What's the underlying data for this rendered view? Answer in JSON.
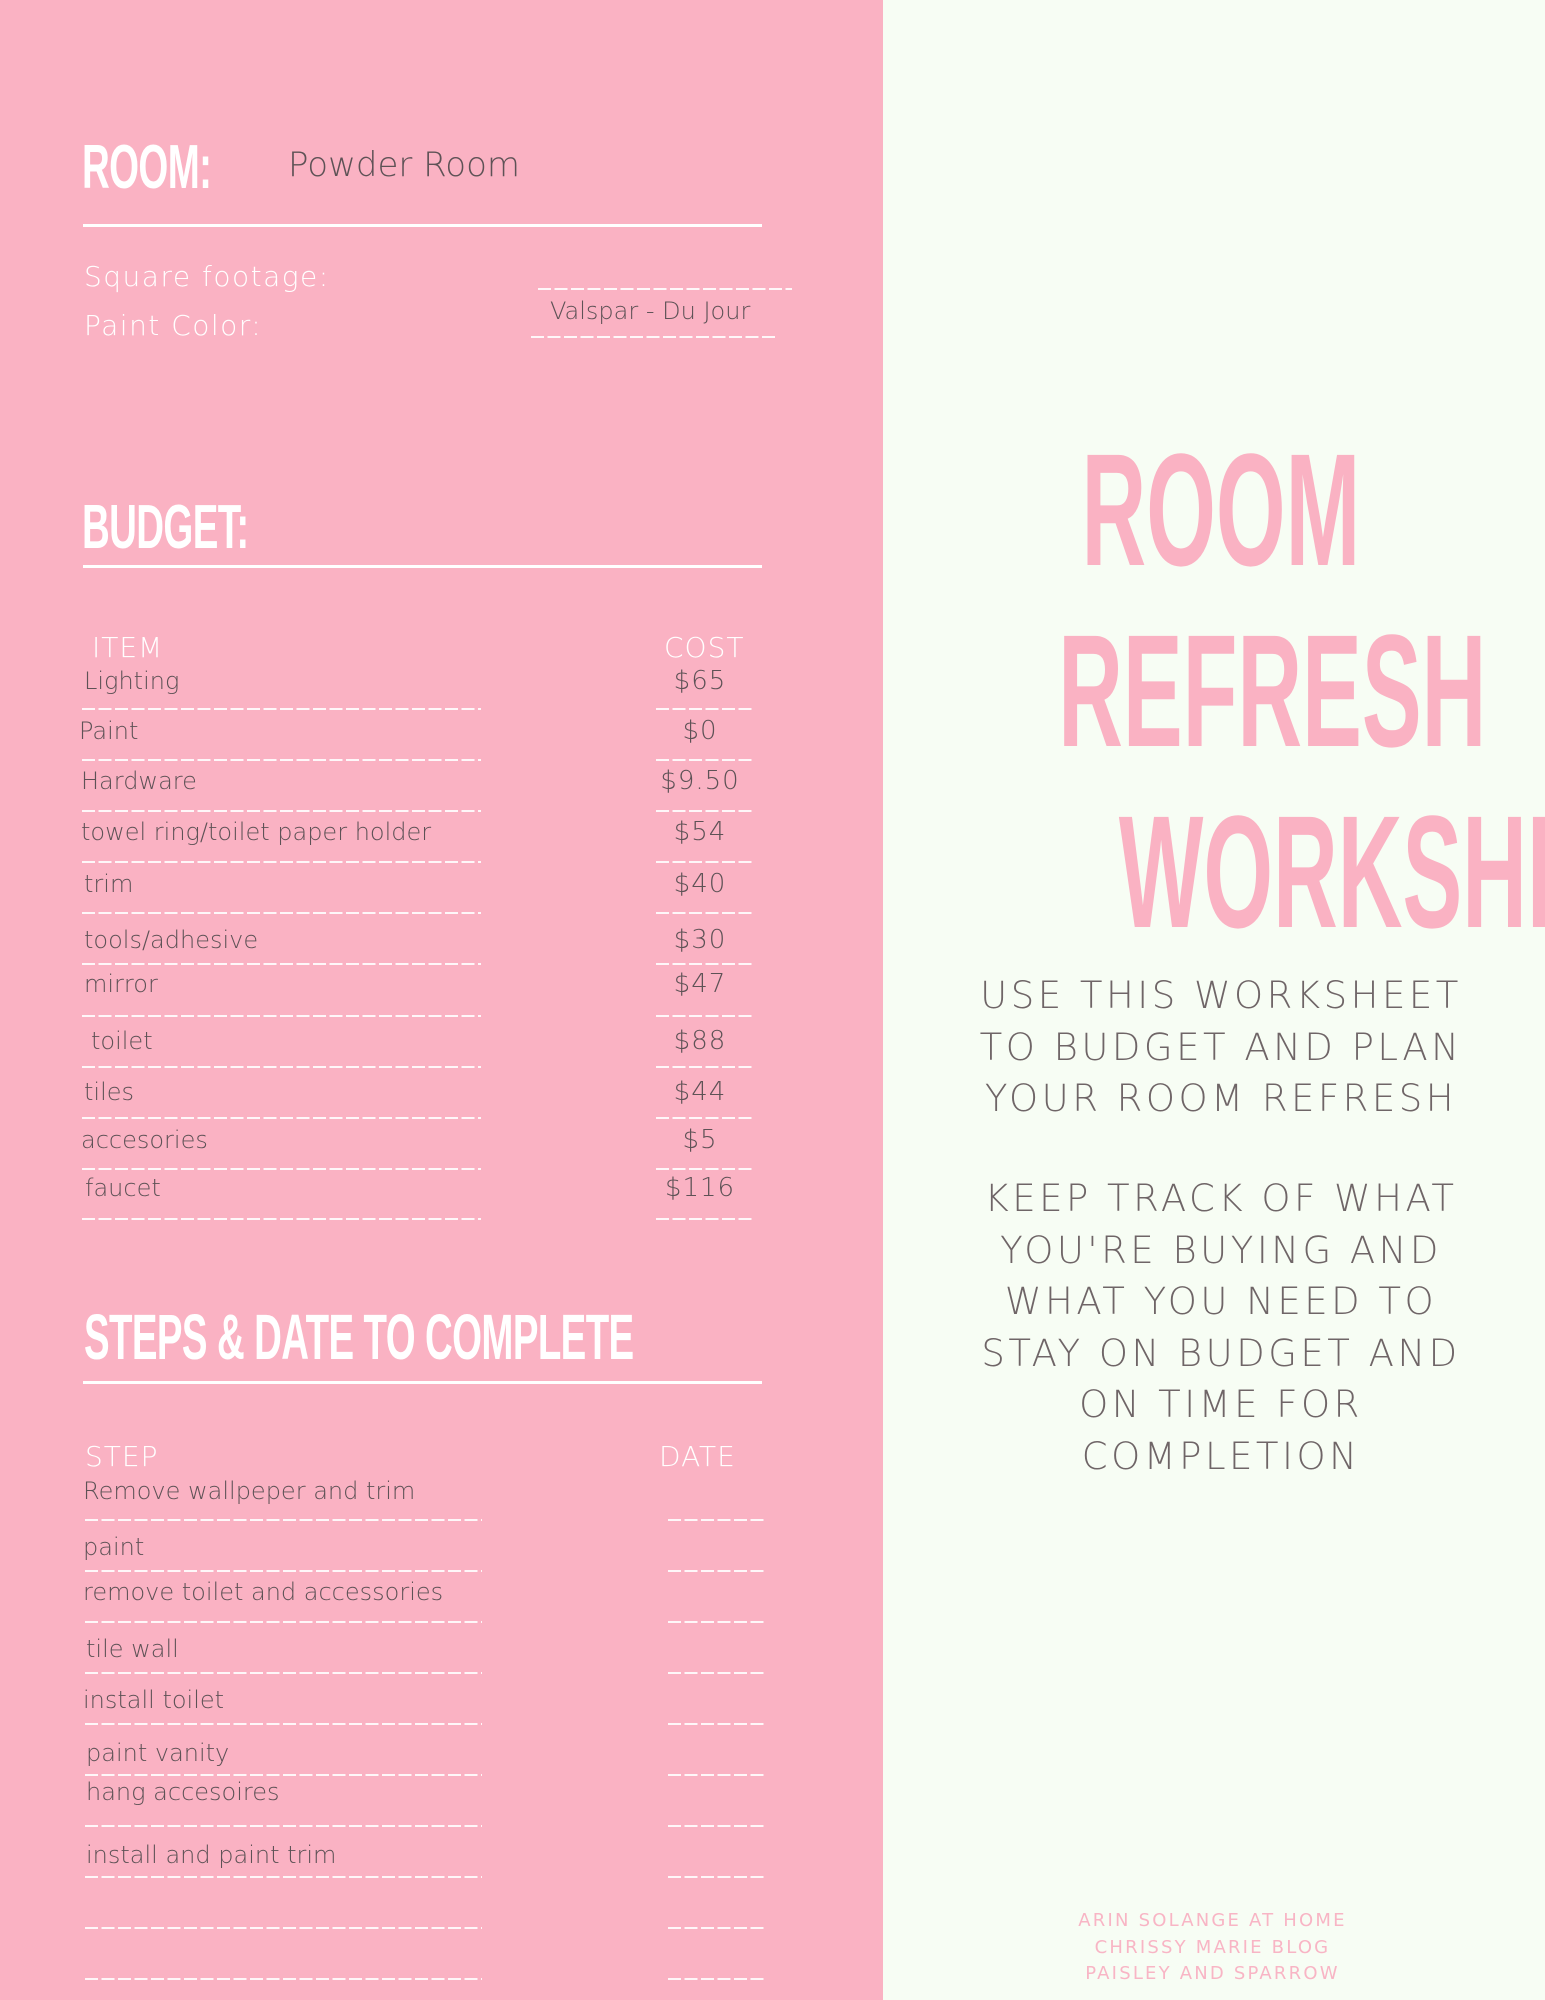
{
  "colors": {
    "left_panel": "#fab2c3",
    "right_panel": "#f7fdf4",
    "title_pink": "#fab2c3",
    "heading_white": "#ffffff",
    "value_gray": "#5e5256",
    "blurb_gray": "#6f6567"
  },
  "room": {
    "heading": "ROOM:",
    "value": "Powder Room",
    "square_footage_label": "Square footage:",
    "square_footage_value": "",
    "paint_color_label": "Paint Color:",
    "paint_color_value": "Valspar - Du Jour"
  },
  "budget": {
    "heading": "BUDGET:",
    "item_header": "ITEM",
    "cost_header": "COST",
    "rows": [
      {
        "item": "Lighting",
        "cost": "$65"
      },
      {
        "item": "Paint",
        "cost": "$0"
      },
      {
        "item": "Hardware",
        "cost": "$9.50"
      },
      {
        "item": "towel ring/toilet paper holder",
        "cost": "$54"
      },
      {
        "item": "trim",
        "cost": "$40"
      },
      {
        "item": "tools/adhesive",
        "cost": "$30"
      },
      {
        "item": "mirror",
        "cost": "$47"
      },
      {
        "item": "toilet",
        "cost": "$88"
      },
      {
        "item": "tiles",
        "cost": "$44"
      },
      {
        "item": "accesories",
        "cost": "$5"
      },
      {
        "item": "faucet",
        "cost": "$116"
      }
    ]
  },
  "steps": {
    "heading": "STEPS & DATE TO COMPLETE",
    "step_header": "STEP",
    "date_header": "DATE",
    "rows": [
      {
        "step": "Remove wallpeper and trim",
        "date": ""
      },
      {
        "step": "paint",
        "date": ""
      },
      {
        "step": "remove toilet and accessories",
        "date": ""
      },
      {
        "step": "tile wall",
        "date": ""
      },
      {
        "step": "install toilet",
        "date": ""
      },
      {
        "step": "paint vanity",
        "date": ""
      },
      {
        "step": "hang accesoires",
        "date": ""
      },
      {
        "step": "install and paint trim",
        "date": ""
      },
      {
        "step": "",
        "date": ""
      },
      {
        "step": "",
        "date": ""
      }
    ]
  },
  "title": {
    "lines": [
      "ROOM",
      "REFRESH",
      "WORKSHEET"
    ]
  },
  "blurb": {
    "paragraph1": [
      "USE THIS WORKSHEET",
      "TO BUDGET AND PLAN",
      "YOUR ROOM REFRESH"
    ],
    "paragraph2": [
      "KEEP TRACK OF WHAT",
      "YOU'RE BUYING AND",
      "WHAT YOU NEED TO",
      "STAY ON BUDGET AND",
      "ON TIME FOR",
      "COMPLETION"
    ]
  },
  "credits": [
    "ARIN SOLANGE AT HOME",
    "CHRISSY MARIE BLOG",
    "PAISLEY AND SPARROW"
  ]
}
